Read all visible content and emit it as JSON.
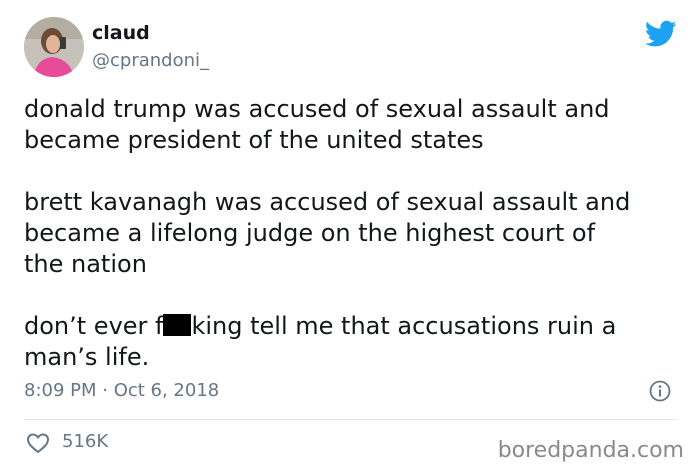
{
  "user": {
    "display_name": "claud",
    "handle": "@cprandoni_"
  },
  "tweet": {
    "paragraph1": "donald trump was accused of sexual assault and\nbecame president of the united states",
    "paragraph2": "brett kavanagh was accused of sexual assault and\nbecame a lifelong judge on the highest court of\nthe nation",
    "paragraph3_before": "don’t ever f",
    "paragraph3_after": "king tell me that accusations ruin a\nman’s life.",
    "timestamp": "8:09 PM · Oct 6, 2018",
    "likes": "516K"
  },
  "watermark": "boredpanda.com",
  "icons": {
    "brand": "twitter-bird-icon",
    "info": "info-icon",
    "like": "heart-icon"
  },
  "colors": {
    "brand": "#1da1f2",
    "text": "#14171a",
    "muted": "#657786"
  }
}
